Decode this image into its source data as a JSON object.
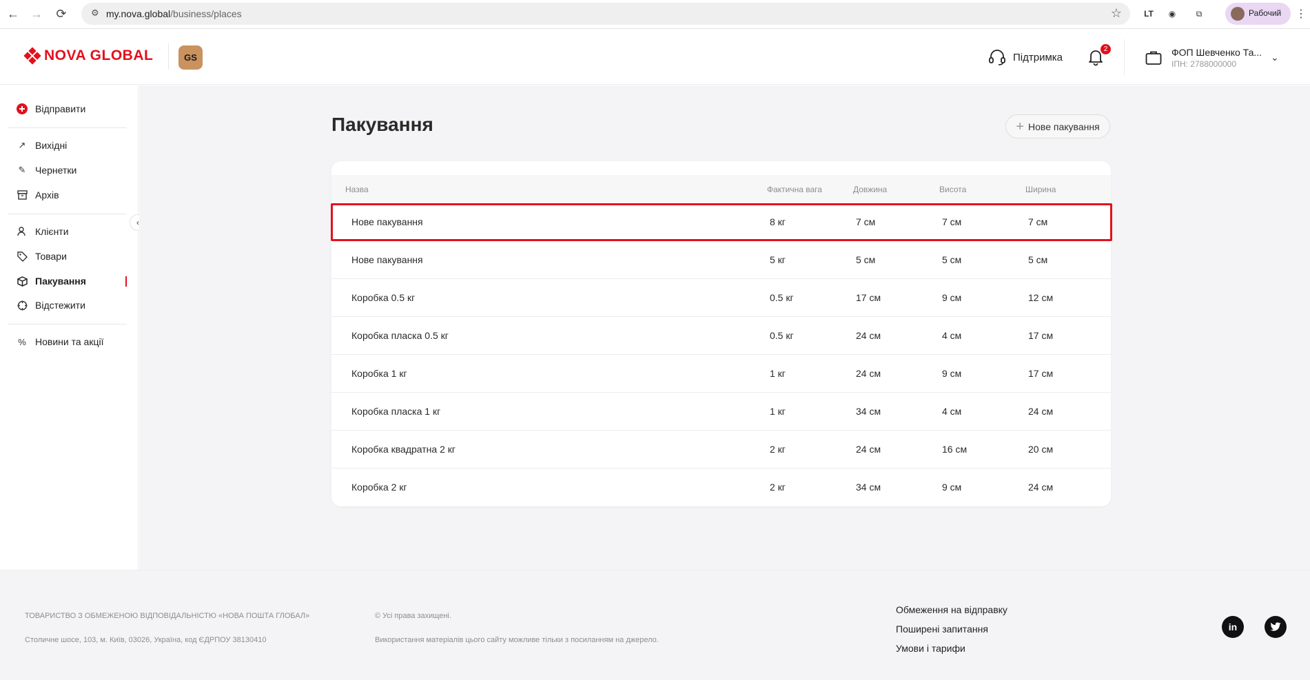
{
  "browser": {
    "url_host": "my.nova.global",
    "url_path": "/business/places",
    "profile_label": "Рабочий",
    "ext_label": "LT"
  },
  "header": {
    "logo_text": "NOVA GLOBAL",
    "badge": "GS",
    "support_label": "Підтримка",
    "notification_count": "2",
    "account_name": "ФОП Шевченко Та...",
    "account_sub": "ІПН: 2788000000"
  },
  "sidebar": {
    "send": "Відправити",
    "outgoing": "Вихідні",
    "drafts": "Чернетки",
    "archive": "Архів",
    "clients": "Клієнти",
    "goods": "Товари",
    "packaging": "Пакування",
    "track": "Відстежити",
    "news": "Новини та акції"
  },
  "main": {
    "title": "Пакування",
    "new_button": "Нове пакування",
    "columns": {
      "name": "Назва",
      "weight": "Фактична вага",
      "length": "Довжина",
      "height": "Висота",
      "width": "Ширина"
    },
    "rows": [
      {
        "name": "Нове пакування",
        "weight": "8 кг",
        "length": "7 см",
        "height": "7 см",
        "width": "7 см"
      },
      {
        "name": "Нове пакування",
        "weight": "5 кг",
        "length": "5 см",
        "height": "5 см",
        "width": "5 см"
      },
      {
        "name": "Коробка 0.5 кг",
        "weight": "0.5 кг",
        "length": "17 см",
        "height": "9 см",
        "width": "12 см"
      },
      {
        "name": "Коробка пласка 0.5 кг",
        "weight": "0.5 кг",
        "length": "24 см",
        "height": "4 см",
        "width": "17 см"
      },
      {
        "name": "Коробка 1 кг",
        "weight": "1 кг",
        "length": "24 см",
        "height": "9 см",
        "width": "17 см"
      },
      {
        "name": "Коробка пласка 1 кг",
        "weight": "1 кг",
        "length": "34 см",
        "height": "4 см",
        "width": "24 см"
      },
      {
        "name": "Коробка квадратна 2 кг",
        "weight": "2 кг",
        "length": "24 см",
        "height": "16 см",
        "width": "20 см"
      },
      {
        "name": "Коробка 2 кг",
        "weight": "2 кг",
        "length": "34 см",
        "height": "9 см",
        "width": "24 см"
      }
    ]
  },
  "footer": {
    "company": "ТОВАРИСТВО З ОБМЕЖЕНОЮ ВІДПОВІДАЛЬНІСТЮ «НОВА ПОШТА ГЛОБАЛ»",
    "address": "Столичне шосе, 103, м. Київ, 03026, Україна, код ЄДРПОУ 38130410",
    "rights": "© Усі права захищені.",
    "usage": "Використання матеріалів цього сайту можливе тільки з посиланням на джерело.",
    "link1": "Обмеження на відправку",
    "link2": "Поширені запитання",
    "link3": "Умови і тарифи",
    "linkedin": "in"
  },
  "colors": {
    "brand_red": "#e3101d",
    "gs_badge": "#c9925f",
    "background": "#f4f4f6"
  }
}
